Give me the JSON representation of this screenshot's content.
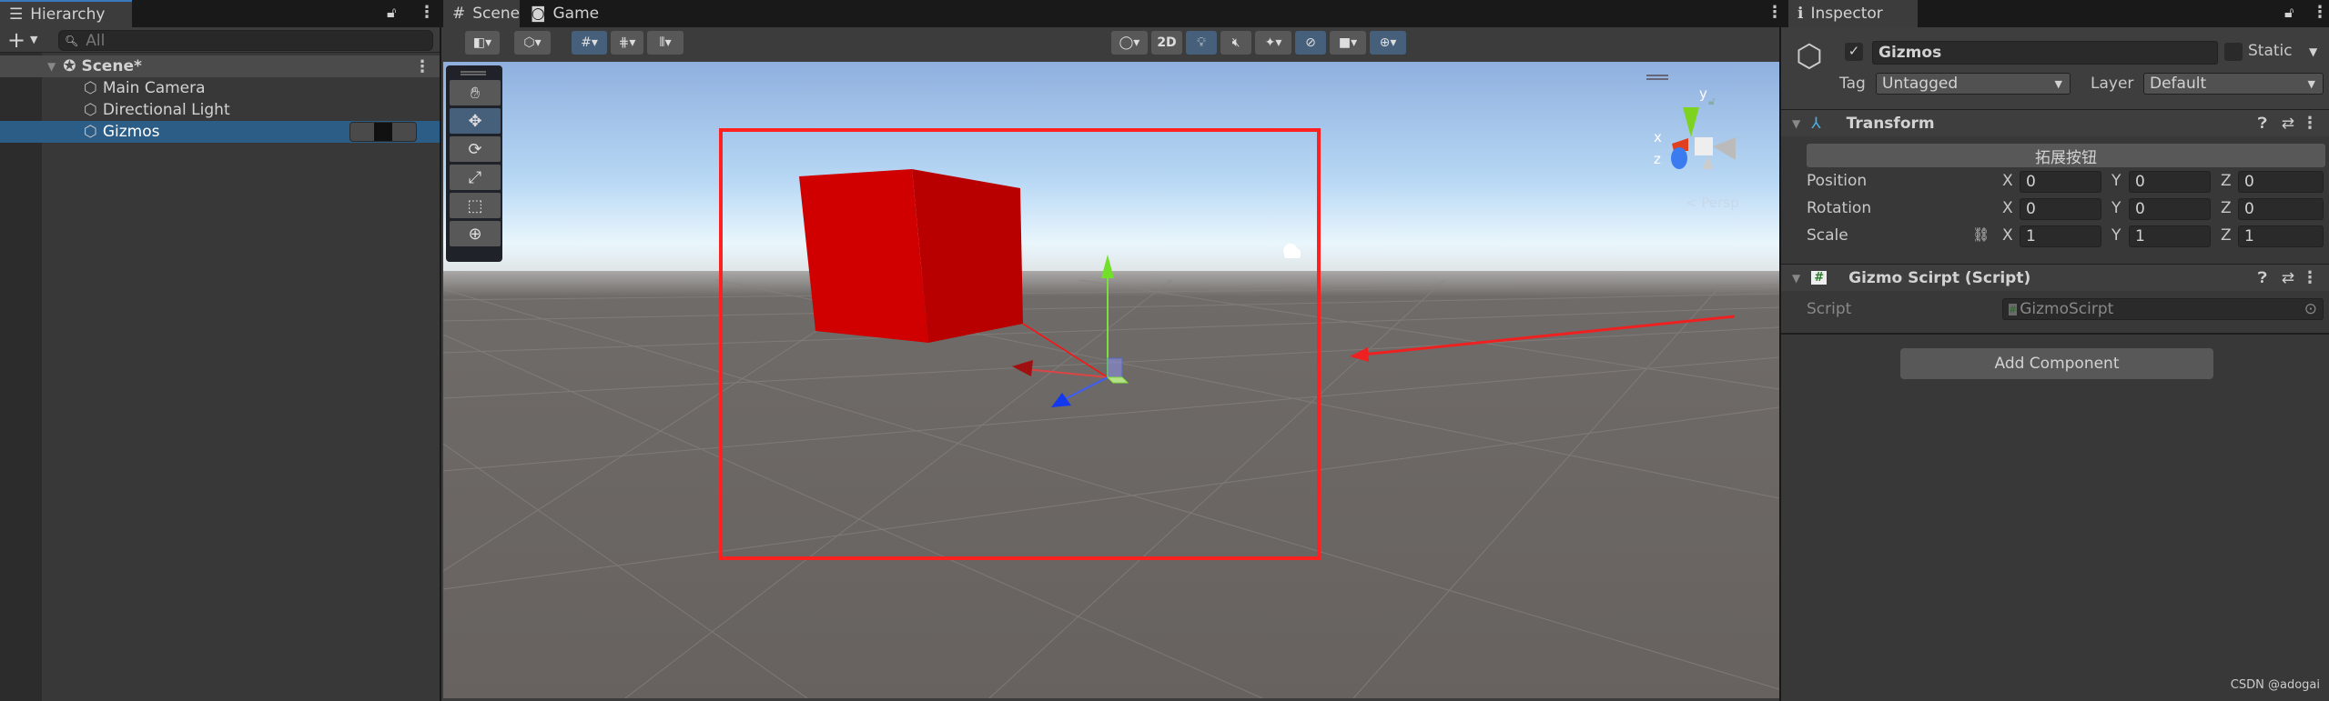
{
  "hierarchy": {
    "tab": "Hierarchy",
    "search_placeholder": "All",
    "scene": "Scene*",
    "items": [
      {
        "label": "Main Camera"
      },
      {
        "label": "Directional Light"
      },
      {
        "label": "Gizmos",
        "selected": true
      }
    ]
  },
  "scene_view": {
    "tabs": [
      {
        "label": "Scene",
        "active": true
      },
      {
        "label": "Game"
      }
    ],
    "toolbar": {
      "mode_2d": "2D"
    },
    "nav_gizmo": {
      "x": "x",
      "y": "y",
      "z": "z",
      "projection": "Persp"
    },
    "colors": {
      "cube": "#d10000",
      "highlight_box": "#ff2020",
      "sky": "#8fb0de",
      "ground": "#686360"
    },
    "tools": [
      {
        "name": "hand"
      },
      {
        "name": "move",
        "active": true
      },
      {
        "name": "rotate"
      },
      {
        "name": "scale"
      },
      {
        "name": "rect"
      },
      {
        "name": "transform"
      }
    ]
  },
  "inspector": {
    "tab": "Inspector",
    "object_name": "Gizmos",
    "active": true,
    "static_label": "Static",
    "tag_label": "Tag",
    "tag_value": "Untagged",
    "layer_label": "Layer",
    "layer_value": "Default",
    "transform": {
      "title": "Transform",
      "extension_button": "拓展按钮",
      "rows": [
        {
          "label": "Position",
          "x": "0",
          "y": "0",
          "z": "0"
        },
        {
          "label": "Rotation",
          "x": "0",
          "y": "0",
          "z": "0"
        },
        {
          "label": "Scale",
          "x": "1",
          "y": "1",
          "z": "1"
        }
      ],
      "axis": {
        "x": "X",
        "y": "Y",
        "z": "Z"
      }
    },
    "script_component": {
      "title": "Gizmo Scirpt (Script)",
      "script_label": "Script",
      "script_value": "GizmoScirpt"
    },
    "add_component": "Add Component"
  },
  "watermark": "CSDN @adogai"
}
